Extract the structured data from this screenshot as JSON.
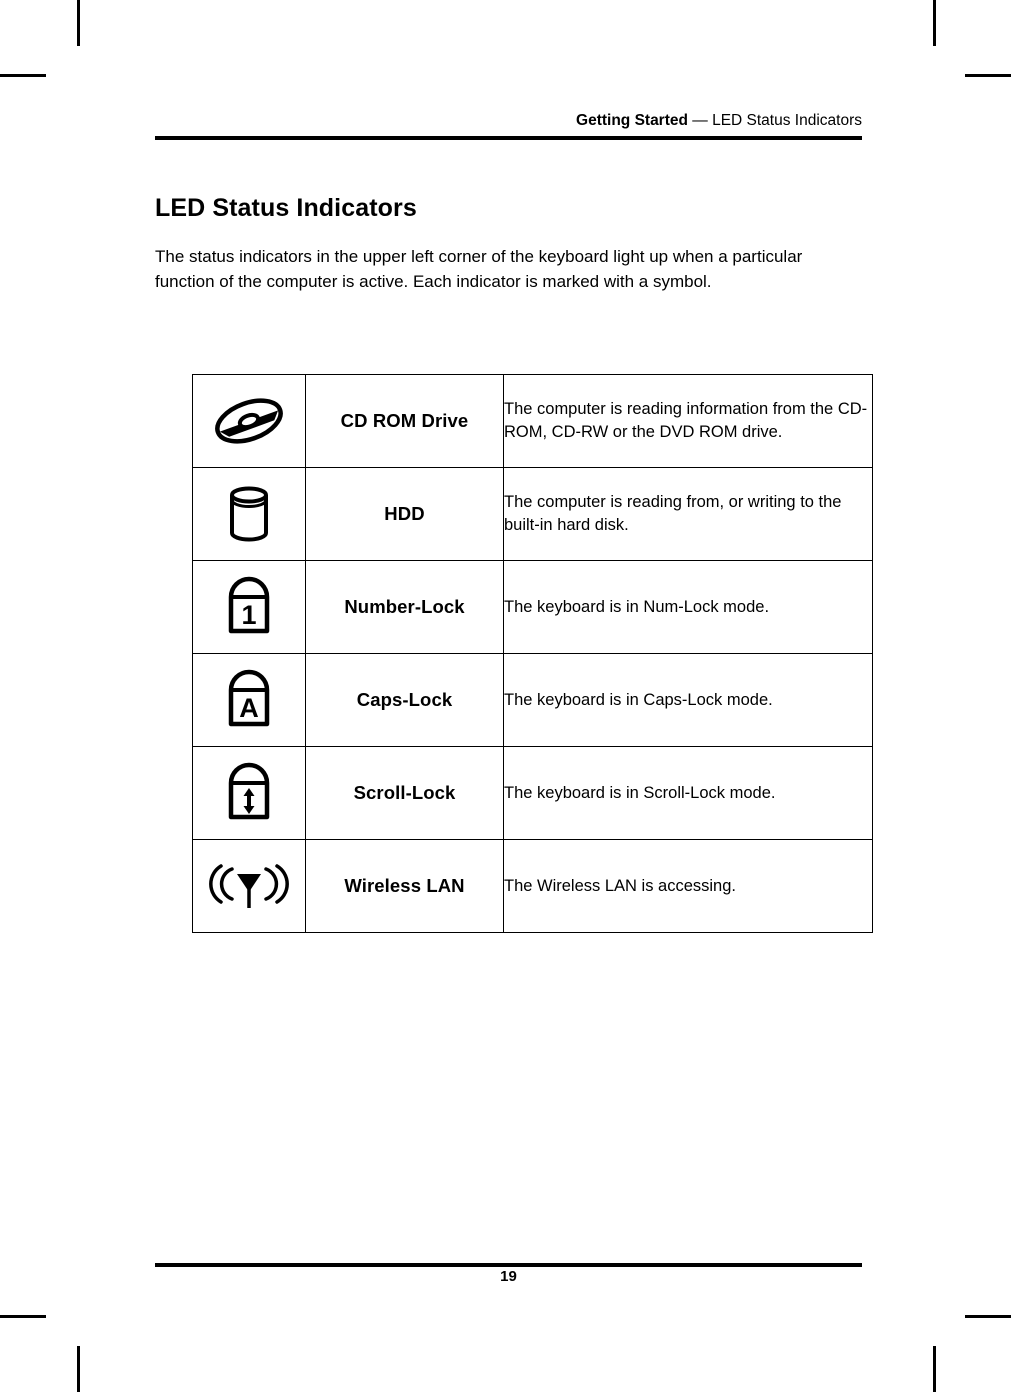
{
  "header": {
    "section_bold": "Getting Started",
    "section_rest": " — LED Status Indicators"
  },
  "title": "LED Status Indicators",
  "intro": "The status indicators in the upper left corner of the keyboard light up when a particular function of the computer is active. Each indicator is marked with a symbol.",
  "table": {
    "rows": [
      {
        "icon": "cd-rom-disc-icon",
        "label": "CD ROM Drive",
        "description": "The computer is reading information from the CD-ROM, CD-RW or the DVD ROM drive."
      },
      {
        "icon": "hard-disk-cylinder-icon",
        "label": "HDD",
        "description": "The computer is reading from, or writing to the built-in hard disk."
      },
      {
        "icon": "number-lock-padlock-icon",
        "icon_glyph": "1",
        "label": "Number-Lock",
        "description": "The keyboard is in Num-Lock mode."
      },
      {
        "icon": "caps-lock-padlock-icon",
        "icon_glyph": "A",
        "label": "Caps-Lock",
        "description": "The keyboard is in Caps-Lock mode."
      },
      {
        "icon": "scroll-lock-padlock-icon",
        "icon_glyph": "↕",
        "label": "Scroll-Lock",
        "description": "The keyboard is in Scroll-Lock mode."
      },
      {
        "icon": "wireless-lan-antenna-icon",
        "label": "Wireless LAN",
        "description": "The Wireless LAN is accessing."
      }
    ]
  },
  "footer": {
    "page_number": "19"
  },
  "colors": {
    "ink": "#000000",
    "paper": "#ffffff"
  }
}
